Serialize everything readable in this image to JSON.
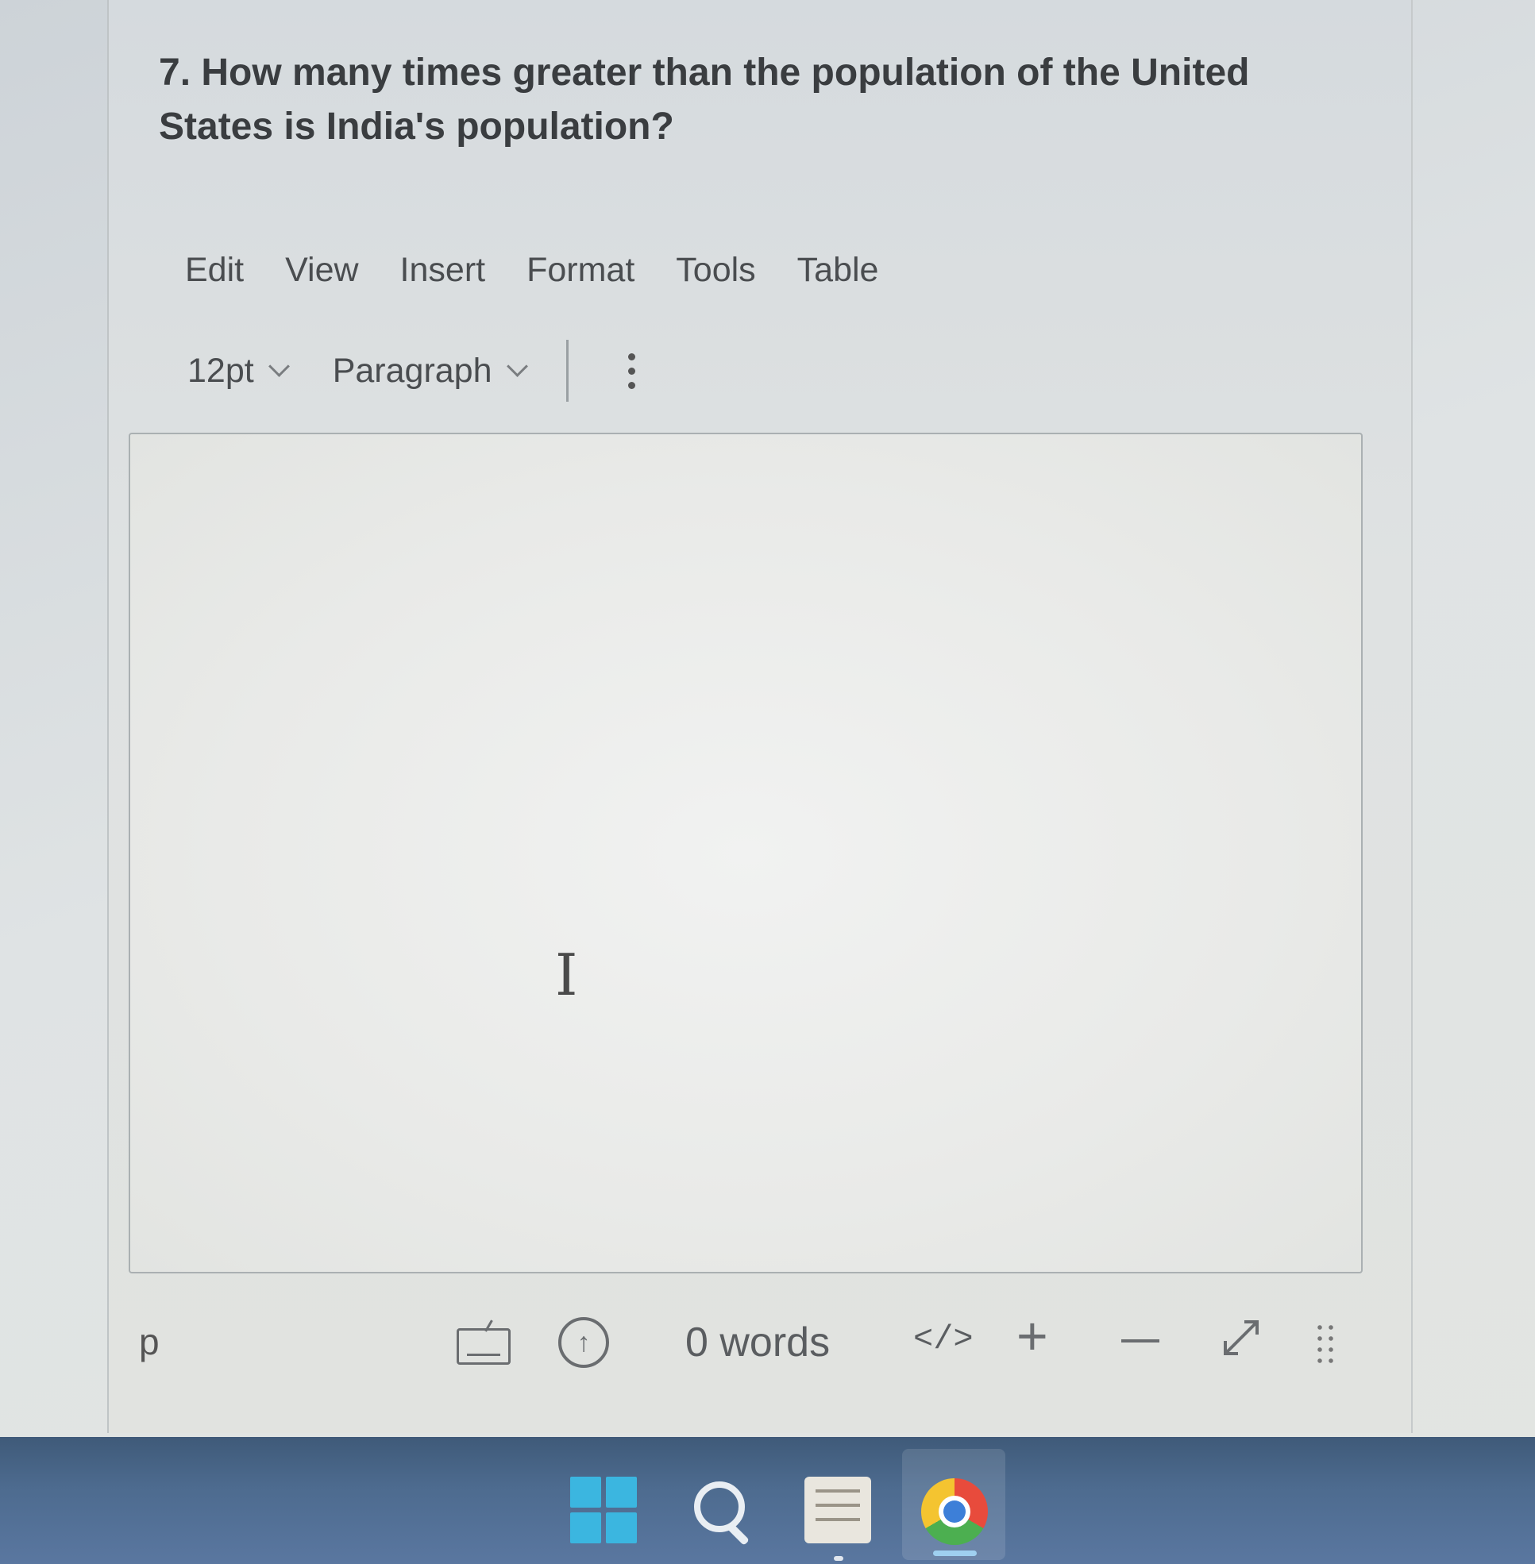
{
  "question": {
    "text": "7. How many times greater than the population of the United States is India's population?"
  },
  "menubar": {
    "items": [
      {
        "label": "Edit"
      },
      {
        "label": "View"
      },
      {
        "label": "Insert"
      },
      {
        "label": "Format"
      },
      {
        "label": "Tools"
      },
      {
        "label": "Table"
      }
    ]
  },
  "toolbar": {
    "font_size": "12pt",
    "block_format": "Paragraph",
    "more_icon": "kebab-vertical-icon"
  },
  "editor": {
    "content": "",
    "cursor_icon": "text-cursor-ibeam-icon"
  },
  "statusbar": {
    "path": "p",
    "keyboard_icon": "keyboard-icon",
    "accessibility_icon": "accessibility-icon",
    "word_count": "0 words",
    "code_label": "</>",
    "zoom_in_label": "+",
    "expand_icon": "expand-diagonal-icon",
    "resize_icon": "resize-grip-icon"
  },
  "taskbar": {
    "icons": [
      "windows-start-icon",
      "search-icon",
      "app-icon",
      "chrome-icon"
    ],
    "accent_color": "#3bb6e0",
    "background_color": "#4d6b8f"
  }
}
